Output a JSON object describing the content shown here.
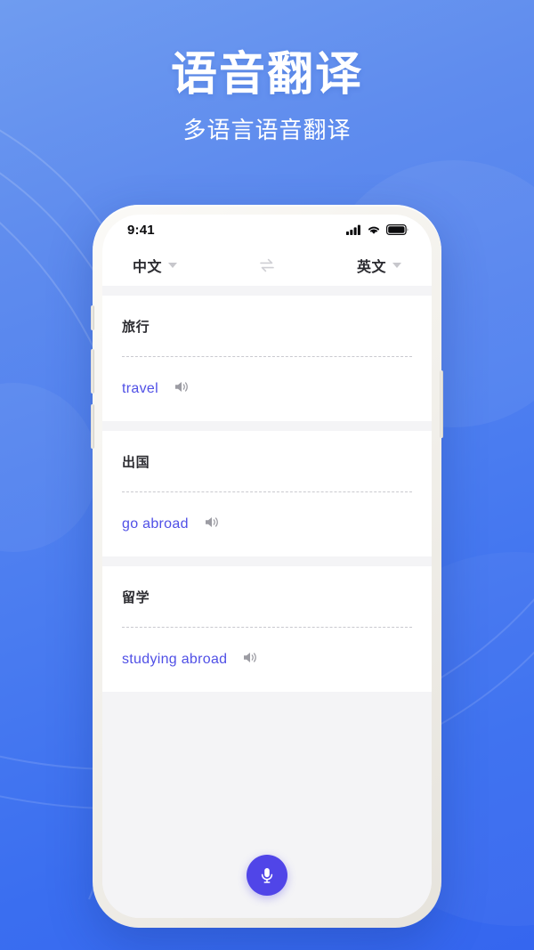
{
  "poster": {
    "title": "语音翻译",
    "subtitle": "多语言语音翻译",
    "bg_gradient_from": "#6f9cf0",
    "bg_gradient_to": "#3566ef",
    "title_color": "#ffffff"
  },
  "phone": {
    "status_bar": {
      "time": "9:41",
      "cellular_icon": "cellular-signal-icon",
      "wifi_icon": "wifi-icon",
      "battery_icon": "battery-full-icon"
    },
    "language_bar": {
      "source_language": "中文",
      "target_language": "英文",
      "swap_icon": "swap-arrows-icon",
      "caret_icon": "chevron-down-icon"
    },
    "cards": [
      {
        "source": "旅行",
        "translation": "travel",
        "speaker_icon": "speaker-icon"
      },
      {
        "source": "出国",
        "translation": "go abroad",
        "speaker_icon": "speaker-icon"
      },
      {
        "source": "留学",
        "translation": "studying abroad",
        "speaker_icon": "speaker-icon"
      }
    ],
    "mic_button": {
      "icon": "microphone-icon",
      "color": "#5045e8"
    },
    "translation_color": "#5050e6",
    "source_color": "#2c2c31"
  }
}
